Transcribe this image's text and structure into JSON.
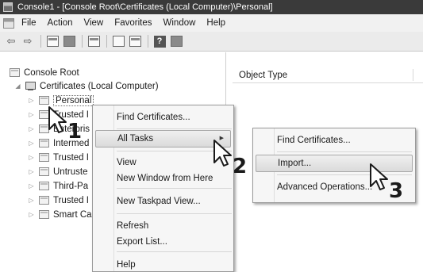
{
  "window": {
    "title": "Console1 - [Console Root\\Certificates (Local Computer)\\Personal]"
  },
  "menubar": {
    "items": [
      "File",
      "Action",
      "View",
      "Favorites",
      "Window",
      "Help"
    ]
  },
  "toolbar": {
    "buttons": [
      "back-arrow-icon",
      "forward-arrow-icon",
      "up-folder-icon",
      "show-hide-tree-icon",
      "properties-icon",
      "refresh-icon",
      "export-list-icon",
      "help-icon",
      "action-pane-icon"
    ]
  },
  "tree": {
    "root": "Console Root",
    "certificates": "Certificates (Local Computer)",
    "children": [
      "Personal",
      "Trusted I",
      "Enterpris",
      "Intermed",
      "Trusted I",
      "Untruste",
      "Third-Pa",
      "Trusted I",
      "Smart Ca"
    ]
  },
  "list": {
    "column_header": "Object Type"
  },
  "context_menu": {
    "items": [
      "Find Certificates...",
      "All Tasks",
      "View",
      "New Window from Here",
      "New Taskpad View...",
      "Refresh",
      "Export List...",
      "Help"
    ]
  },
  "submenu": {
    "items": [
      "Find Certificates...",
      "Import...",
      "Advanced Operations..."
    ]
  },
  "steps": [
    "1",
    "2",
    "3"
  ],
  "colors": {
    "titlebar": "#3a3a3a",
    "menu_bg": "#f6f6f6",
    "highlight": "#dadada"
  }
}
